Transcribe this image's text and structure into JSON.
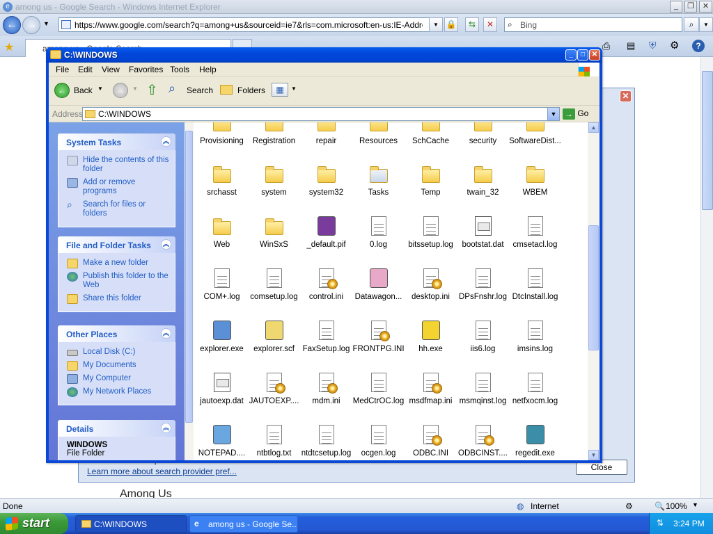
{
  "ie": {
    "title": "among us - Google Search - Windows Internet Explorer",
    "url": "https://www.google.com/search?q=among+us&sourceid=ie7&rls=com.microsoft:en-us:IE-Address&ie=&oe=&",
    "search_placeholder": "Bing",
    "tab_label": "among us - Google Search",
    "dialog_link": "Learn more about search provider pref...",
    "dialog_partial": "Find more search prov...",
    "dialog_close": "Close",
    "page_heading": "Among Us",
    "status_left": "Done",
    "status_zone": "Internet",
    "zoom": "100%"
  },
  "explorer": {
    "title": "C:\\WINDOWS",
    "menu": [
      "File",
      "Edit",
      "View",
      "Favorites",
      "Tools",
      "Help"
    ],
    "toolbar": {
      "back": "Back",
      "search": "Search",
      "folders": "Folders"
    },
    "address_label": "Address",
    "address_value": "C:\\WINDOWS",
    "go_label": "Go",
    "system_tasks": {
      "title": "System Tasks",
      "items": [
        "Hide the contents of this folder",
        "Add or remove programs",
        "Search for files or folders"
      ]
    },
    "file_folder_tasks": {
      "title": "File and Folder Tasks",
      "items": [
        "Make a new folder",
        "Publish this folder to the Web",
        "Share this folder"
      ]
    },
    "other_places": {
      "title": "Other Places",
      "items": [
        "Local Disk (C:)",
        "My Documents",
        "My Computer",
        "My Network Places"
      ]
    },
    "details": {
      "title": "Details",
      "name": "WINDOWS",
      "type": "File Folder"
    },
    "rows": [
      [
        "Provisioning",
        "Registration",
        "repair",
        "Resources",
        "SchCache",
        "security",
        "SoftwareDist..."
      ],
      [
        "srchasst",
        "system",
        "system32",
        "Tasks",
        "Temp",
        "twain_32",
        "WBEM"
      ],
      [
        "Web",
        "WinSxS",
        "_default.pif",
        "0.log",
        "bitssetup.log",
        "bootstat.dat",
        "cmsetacl.log"
      ],
      [
        "COM+.log",
        "comsetup.log",
        "control.ini",
        "Datawagon...",
        "desktop.ini",
        "DPsFnshr.log",
        "DtcInstall.log"
      ],
      [
        "explorer.exe",
        "explorer.scf",
        "FaxSetup.log",
        "FRONTPG.INI",
        "hh.exe",
        "iis6.log",
        "imsins.log"
      ],
      [
        "jautoexp.dat",
        "JAUTOEXP....",
        "mdm.ini",
        "MedCtrOC.log",
        "msdfmap.ini",
        "msmqinst.log",
        "netfxocm.log"
      ],
      [
        "NOTEPAD....",
        "ntbtlog.txt",
        "ntdtcsetup.log",
        "ocgen.log",
        "ODBC.INI",
        "ODBCINST....",
        "regedit.exe"
      ]
    ]
  },
  "taskbar": {
    "start": "start",
    "items": [
      "C:\\WINDOWS",
      "among us - Google Se..."
    ],
    "clock": "3:24 PM"
  }
}
